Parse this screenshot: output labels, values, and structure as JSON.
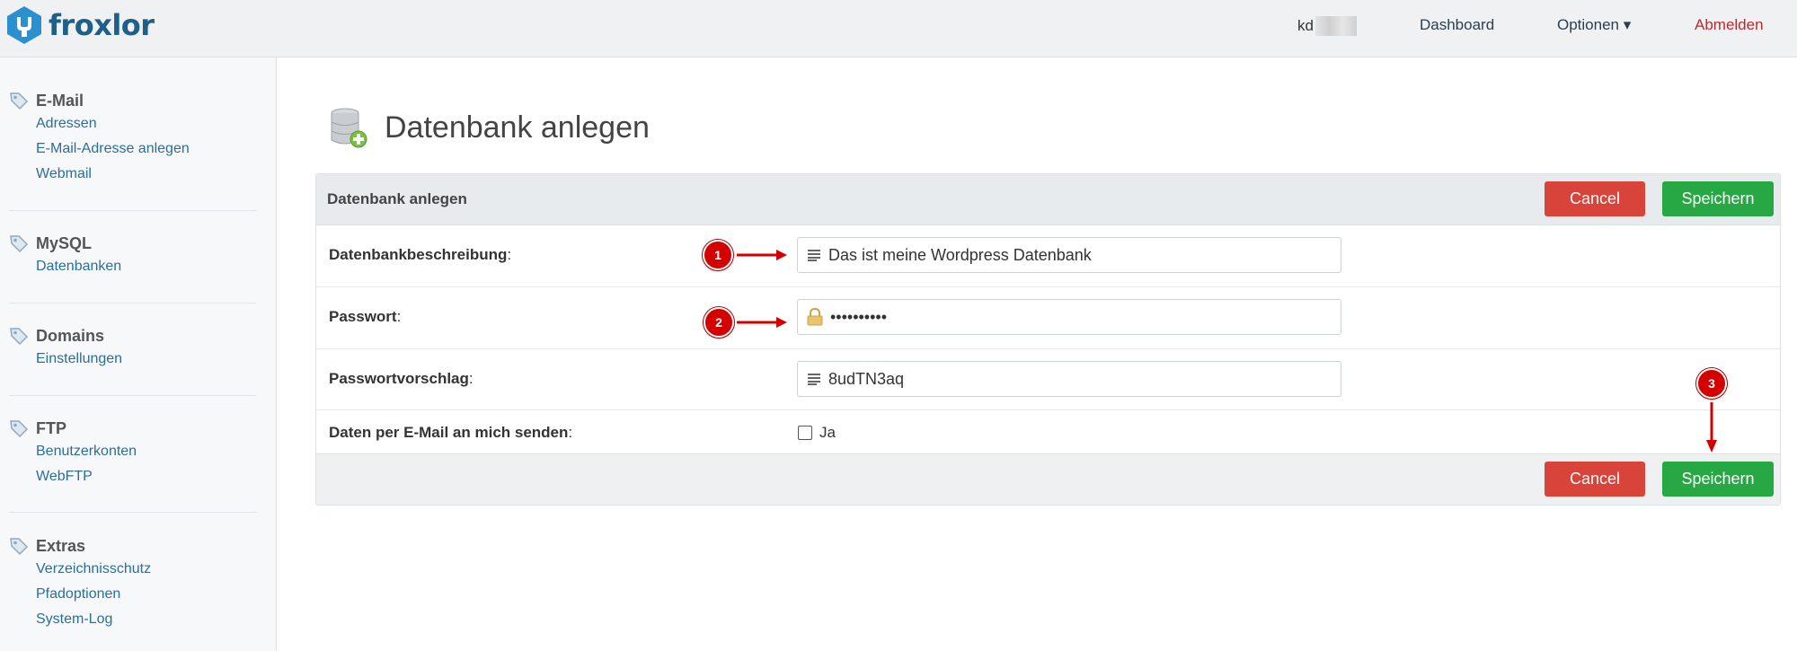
{
  "brand": {
    "name": "froxlor",
    "color": "#1f5f8b"
  },
  "navbar": {
    "user": "kd",
    "links": {
      "dashboard": "Dashboard",
      "optionen": "Optionen ▾",
      "abmelden": "Abmelden"
    }
  },
  "sidebar": {
    "groups": [
      {
        "title": "E-Mail",
        "items": [
          "Adressen",
          "E-Mail-Adresse anlegen",
          "Webmail"
        ]
      },
      {
        "title": "MySQL",
        "items": [
          "Datenbanken"
        ]
      },
      {
        "title": "Domains",
        "items": [
          "Einstellungen"
        ]
      },
      {
        "title": "FTP",
        "items": [
          "Benutzerkonten",
          "WebFTP"
        ]
      },
      {
        "title": "Extras",
        "items": [
          "Verzeichnisschutz",
          "Pfadoptionen",
          "System-Log"
        ]
      }
    ]
  },
  "page": {
    "title": "Datenbank anlegen"
  },
  "form": {
    "header": "Datenbank anlegen",
    "cancel_label": "Cancel",
    "save_label": "Speichern",
    "fields": {
      "beschreibung": {
        "label": "Datenbankbeschreibung",
        "value": "Das ist meine Wordpress Datenbank"
      },
      "passwort": {
        "label": "Passwort",
        "value": "••••••••••"
      },
      "vorschlag": {
        "label": "Passwortvorschlag",
        "value": "8udTN3aq"
      },
      "email": {
        "label": "Daten per E-Mail an mich senden",
        "option": "Ja",
        "checked": false
      }
    },
    "colon": ":"
  },
  "annotations": {
    "m1": "1",
    "m2": "2",
    "m3": "3"
  },
  "colors": {
    "cancel": "#d9443a",
    "save": "#28a745",
    "annotation": "#d40000",
    "logout": "#c0282d"
  }
}
